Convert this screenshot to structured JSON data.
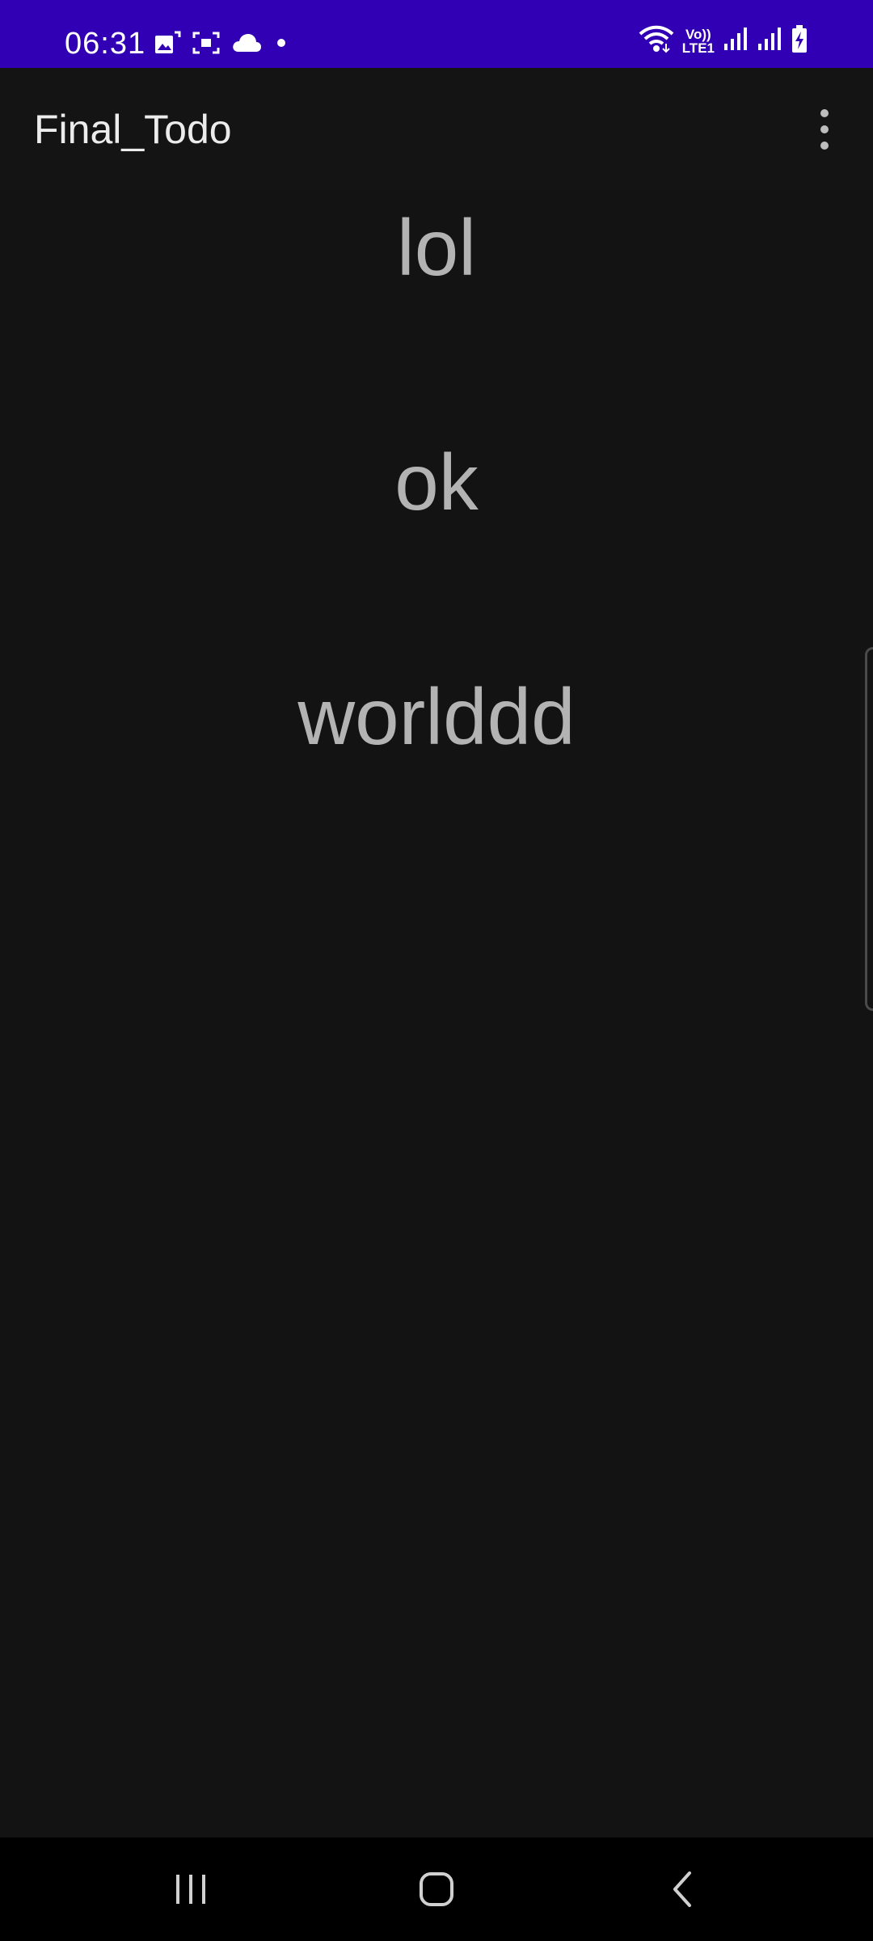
{
  "status_bar": {
    "time": "06:31",
    "network_label_top": "Vo))",
    "network_label_bottom": "LTE1",
    "left_icons": [
      "gallery-icon",
      "screenshot-icon",
      "cloud-icon",
      "dot-icon"
    ],
    "right_icons": [
      "wifi-icon",
      "signal-icon",
      "signal-icon",
      "battery-charging-icon"
    ],
    "background_color": "#3200b4"
  },
  "app_bar": {
    "title": "Final_Todo",
    "menu_icon": "more-vert-icon"
  },
  "todos": [
    {
      "text": "lol"
    },
    {
      "text": "ok"
    },
    {
      "text": "worlddd"
    }
  ],
  "nav_bar": {
    "buttons": [
      "recent-apps-icon",
      "home-icon",
      "back-icon"
    ]
  }
}
